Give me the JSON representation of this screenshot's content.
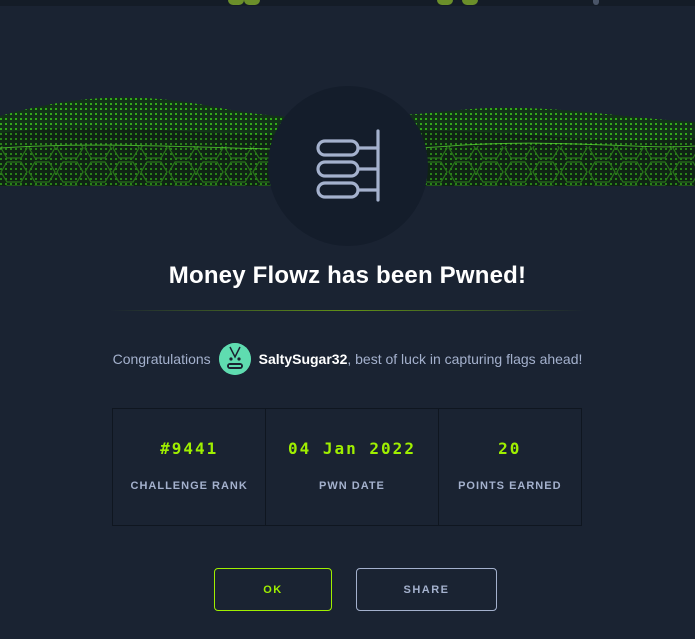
{
  "title": "Money Flowz has been Pwned!",
  "congrats": {
    "prefix": "Congratulations",
    "username": "SaltySugar32",
    "suffix": ", best of luck in capturing flags ahead!"
  },
  "stats": [
    {
      "value": "#9441",
      "label": "CHALLENGE RANK"
    },
    {
      "value": "04 Jan 2022",
      "label": "PWN DATE"
    },
    {
      "value": "20",
      "label": "POINTS EARNED"
    }
  ],
  "buttons": {
    "ok": "OK",
    "share": "SHARE"
  },
  "icons": {
    "challenge": "database-stack-icon",
    "avatar": "user-avatar"
  },
  "colors": {
    "background": "#1a2332",
    "accent": "#9fef00",
    "muted_text": "#a4b1cd",
    "icon_stroke": "#a4b1cd",
    "circle_bg": "#141d2b"
  }
}
